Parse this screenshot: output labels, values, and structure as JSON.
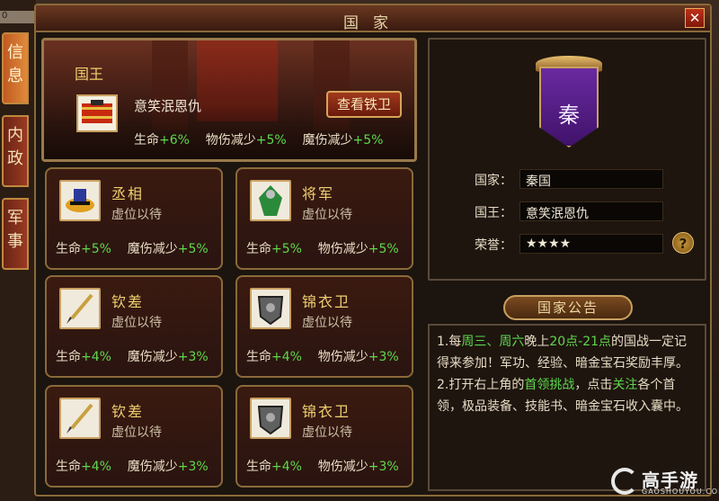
{
  "window": {
    "title": "国家",
    "close_label": "✕",
    "corner_value": "0"
  },
  "tabs": [
    {
      "label": "信息",
      "active": true
    },
    {
      "label": "内政",
      "active": false
    },
    {
      "label": "军事",
      "active": false
    }
  ],
  "king": {
    "title": "国王",
    "name": "意笑泯恩仇",
    "view_button": "查看铁卫",
    "stats": {
      "hp_label": "生命",
      "hp": "+6%",
      "phys_label": "物伤减少",
      "phys": "+5%",
      "magic_label": "魔伤减少",
      "magic": "+5%"
    }
  },
  "positions": [
    {
      "rank": "丞相",
      "status": "虚位以待",
      "hp_label": "生命",
      "hp": "+5%",
      "def_label": "魔伤减少",
      "def": "+5%"
    },
    {
      "rank": "将军",
      "status": "虚位以待",
      "hp_label": "生命",
      "hp": "+5%",
      "def_label": "物伤减少",
      "def": "+5%"
    },
    {
      "rank": "钦差",
      "status": "虚位以待",
      "hp_label": "生命",
      "hp": "+4%",
      "def_label": "魔伤减少",
      "def": "+3%"
    },
    {
      "rank": "锦衣卫",
      "status": "虚位以待",
      "hp_label": "生命",
      "hp": "+4%",
      "def_label": "物伤减少",
      "def": "+3%"
    },
    {
      "rank": "钦差",
      "status": "虚位以待",
      "hp_label": "生命",
      "hp": "+4%",
      "def_label": "魔伤减少",
      "def": "+3%"
    },
    {
      "rank": "锦衣卫",
      "status": "虚位以待",
      "hp_label": "生命",
      "hp": "+4%",
      "def_label": "物伤减少",
      "def": "+3%"
    }
  ],
  "nation": {
    "flag_char": "秦",
    "country_label": "国家：",
    "country": "秦国",
    "king_label": "国王：",
    "king": "意笑泯恩仇",
    "honor_label": "荣誉：",
    "honor": "★★★★",
    "help_label": "?"
  },
  "notice": {
    "header": "国家公告",
    "p1_a": "1.每",
    "p1_b": "周三、周六",
    "p1_c": "晚上",
    "p1_d": "20点-21点",
    "p1_e": "的国战一定记得来参加！军功、经验、暗金宝石奖励丰厚。",
    "p2_a": "2.打开右上角的",
    "p2_b": "首领挑战",
    "p2_c": "，点击",
    "p2_d": "关注",
    "p2_e": "各个首领，极品装备、技能书、暗金宝石收入囊中。"
  },
  "watermark": {
    "name": "高手游",
    "sub": "GAOSHOUYOU.COM"
  },
  "colors": {
    "accent_green": "#5ed84c",
    "gold": "#f0cf70",
    "frame": "#8a6a3a"
  }
}
